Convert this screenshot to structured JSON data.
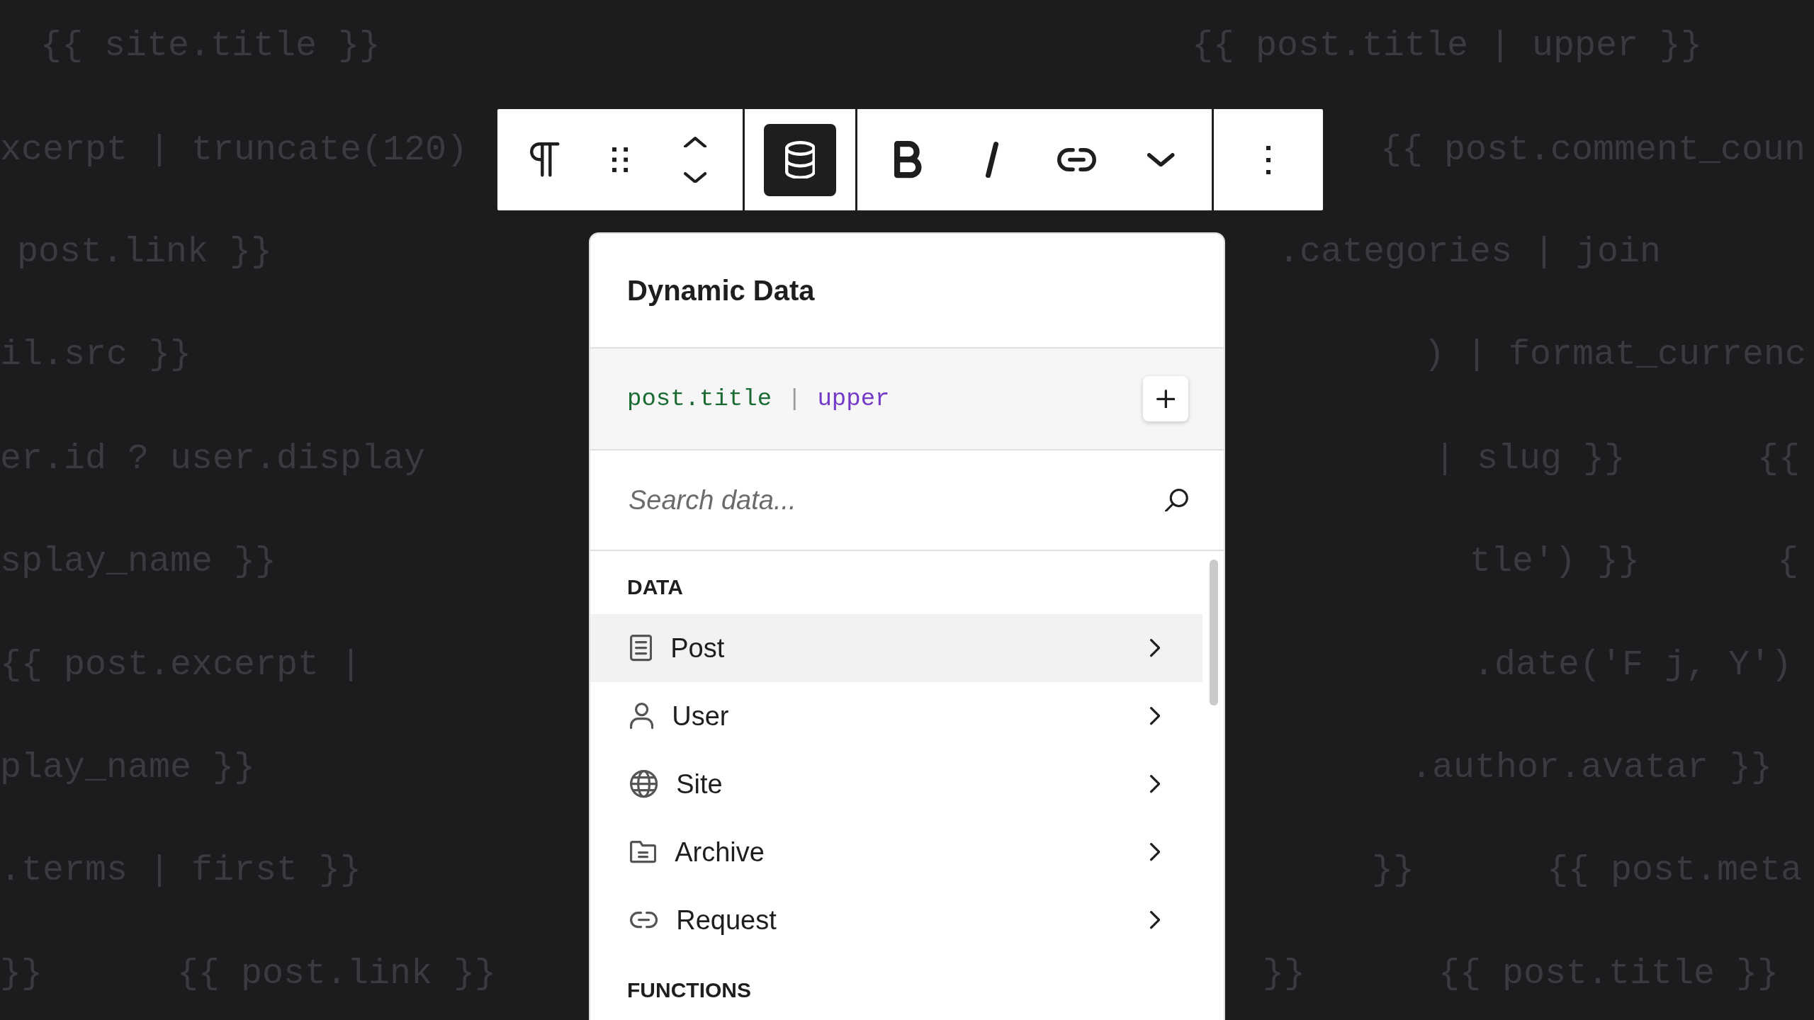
{
  "background_rows": [
    [
      "{{ site.title }}",
      "{{ post.title | upper }}"
    ],
    [
      "xcerpt | truncate(120)",
      "{{ post.comment_coun"
    ],
    [
      "post.link }}",
      ".categories | join"
    ],
    [
      "il.src }}",
      ") | format_currenc"
    ],
    [
      "er.id ? user.display",
      "| slug }}",
      "{{"
    ],
    [
      "splay_name }}",
      "tle') }}",
      "{"
    ],
    [
      "{{ post.excerpt |",
      ".date('F j, Y')"
    ],
    [
      "play_name }}",
      ".author.avatar }}"
    ],
    [
      ".terms | first }}",
      "}}",
      "{{ post.meta"
    ],
    [
      "}}",
      "{{ post.link }}",
      "}}",
      "{{ post.title }}"
    ]
  ],
  "toolbar": {
    "groups": [
      [
        {
          "kind": "paragraph",
          "pressed": false
        },
        {
          "kind": "drag",
          "pressed": false
        },
        {
          "kind": "mover",
          "pressed": false
        }
      ],
      [
        {
          "kind": "database",
          "pressed": true
        }
      ],
      [
        {
          "kind": "bold",
          "pressed": false
        },
        {
          "kind": "italic",
          "pressed": false
        },
        {
          "kind": "link",
          "pressed": false
        },
        {
          "kind": "more",
          "pressed": false
        }
      ],
      [
        {
          "kind": "options",
          "pressed": false
        }
      ]
    ]
  },
  "panel": {
    "title": "Dynamic Data",
    "expression": {
      "path": "post.title",
      "separator": "|",
      "filter": "upper"
    },
    "search": {
      "placeholder": "Search data..."
    },
    "sections": [
      {
        "heading": "DATA",
        "items": [
          {
            "label": "Post",
            "kind": "post",
            "selected": true
          },
          {
            "label": "User",
            "kind": "user",
            "selected": false
          },
          {
            "label": "Site",
            "kind": "site",
            "selected": false
          },
          {
            "label": "Archive",
            "kind": "archive",
            "selected": false
          },
          {
            "label": "Request",
            "kind": "request",
            "selected": false
          }
        ]
      },
      {
        "heading": "FUNCTIONS"
      }
    ]
  }
}
